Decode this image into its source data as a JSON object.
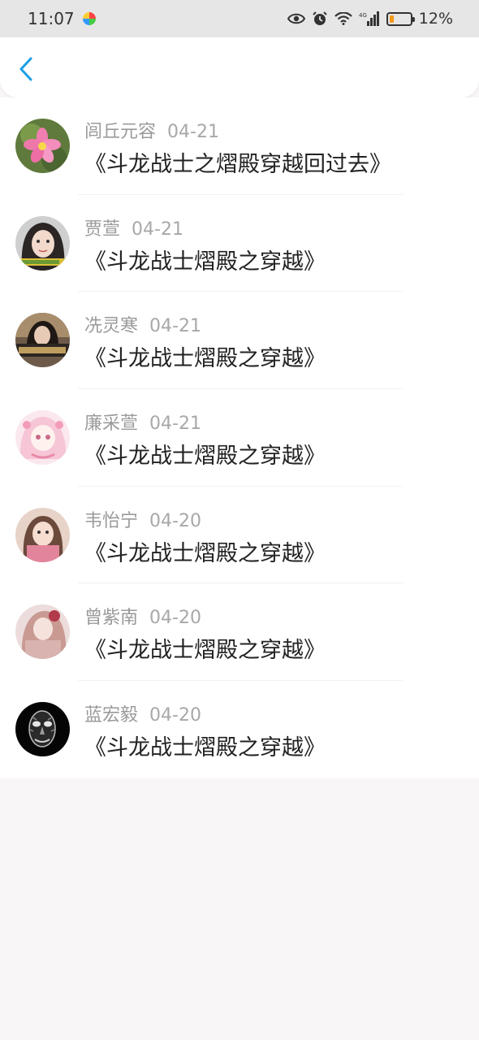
{
  "status_bar": {
    "time": "11:07",
    "battery": "12%",
    "network": "4G"
  },
  "colors": {
    "accent": "#1a9fe8",
    "battery_low": "#f39a1a"
  },
  "nav": {
    "back_icon": "chevron-left-icon"
  },
  "items": [
    {
      "name": "闾丘元容",
      "date": "04-21",
      "title": "《斗龙战士之熠殿穿越回过去》"
    },
    {
      "name": "贾萱",
      "date": "04-21",
      "title": "《斗龙战士熠殿之穿越》"
    },
    {
      "name": "冼灵寒",
      "date": "04-21",
      "title": "《斗龙战士熠殿之穿越》"
    },
    {
      "name": "廉采萱",
      "date": "04-21",
      "title": "《斗龙战士熠殿之穿越》"
    },
    {
      "name": "韦怡宁",
      "date": "04-20",
      "title": "《斗龙战士熠殿之穿越》"
    },
    {
      "name": "曾紫南",
      "date": "04-20",
      "title": "《斗龙战士熠殿之穿越》"
    },
    {
      "name": "蓝宏毅",
      "date": "04-20",
      "title": "《斗龙战士熠殿之穿越》"
    }
  ]
}
